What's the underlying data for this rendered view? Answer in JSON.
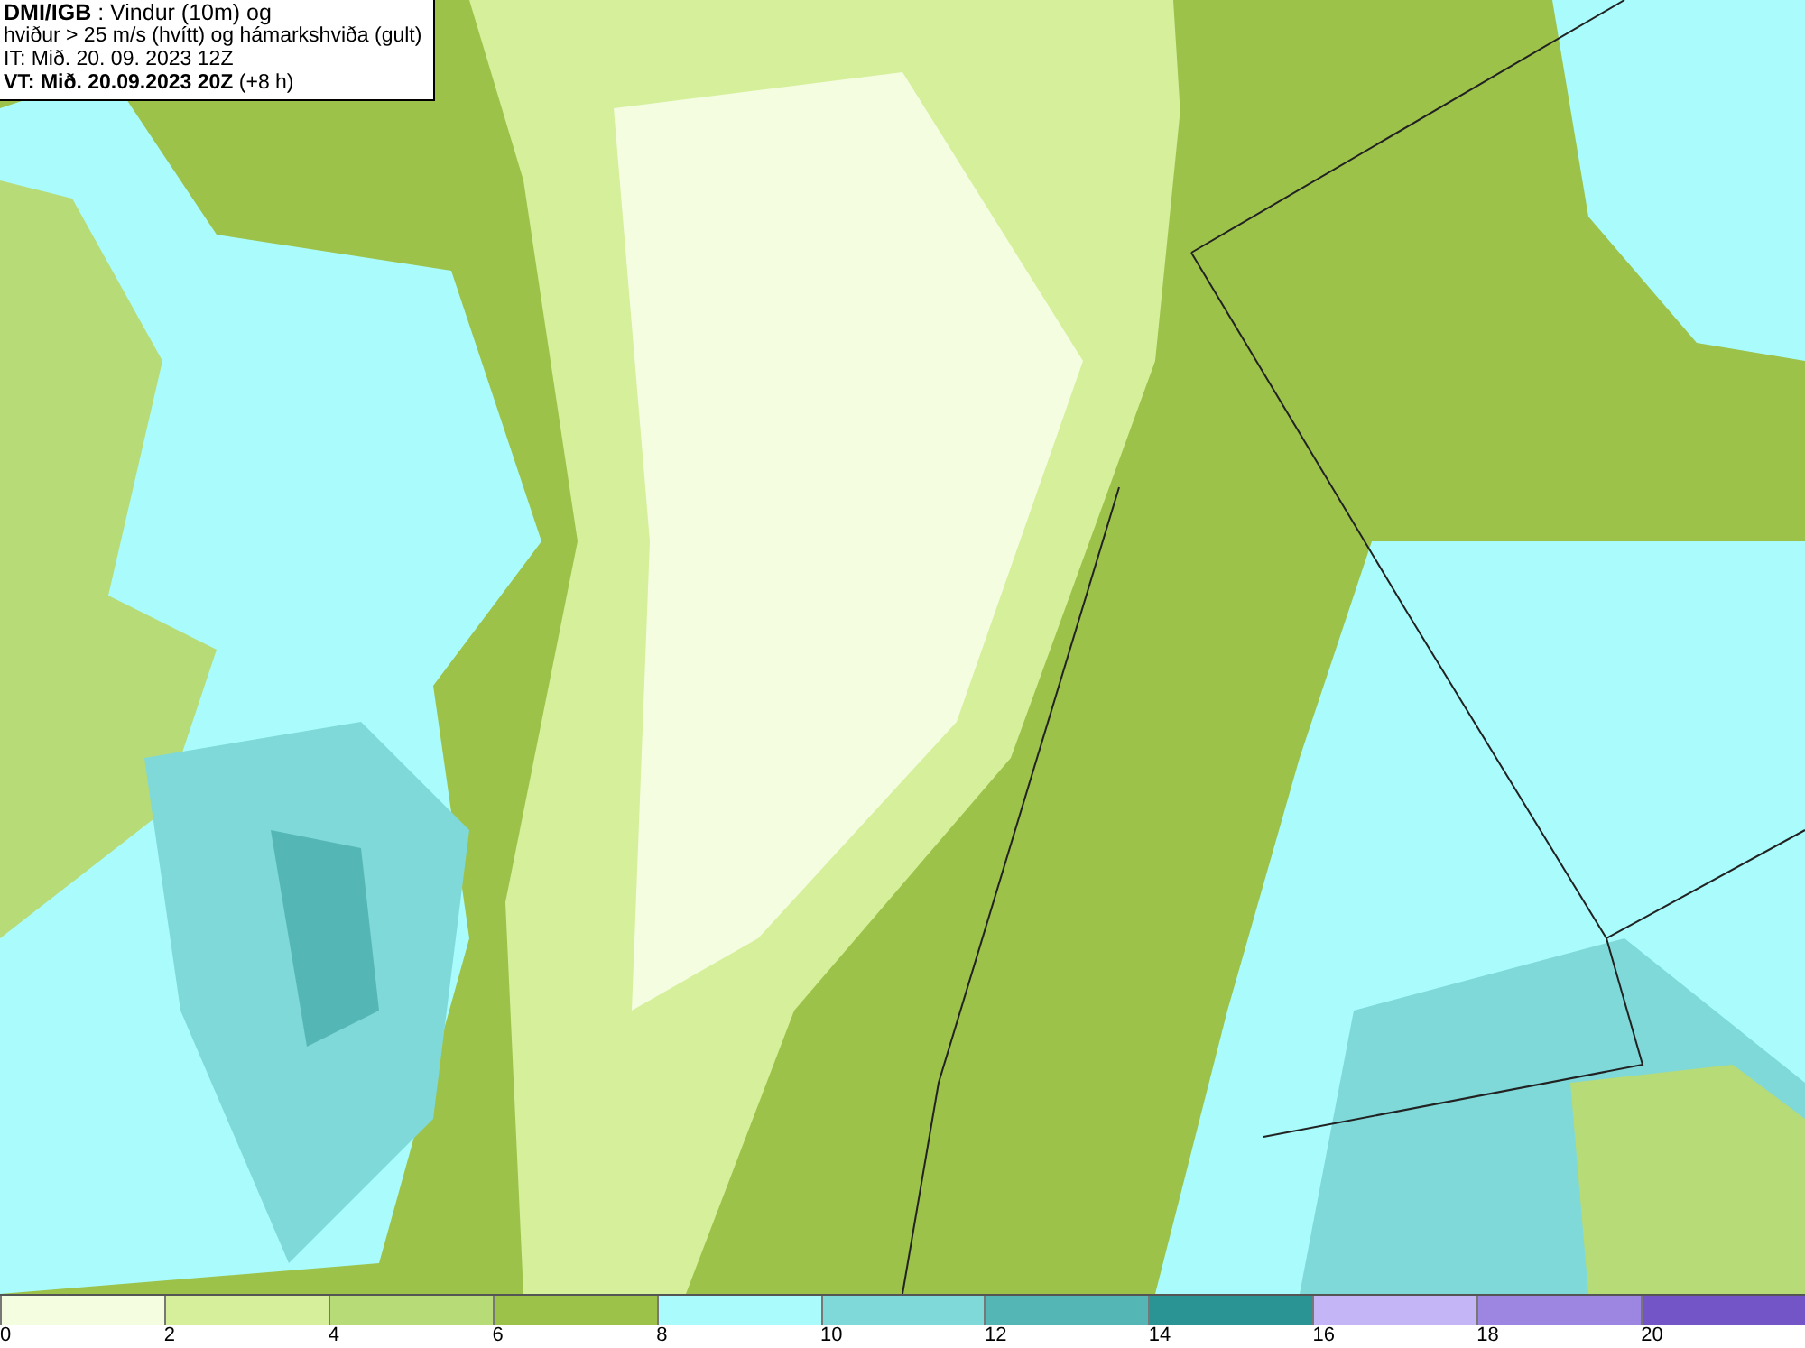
{
  "header": {
    "lines": [
      "**DMI/IGB** : Vindur (10m) og",
      "hviður > 25 m/s (hvítt) og hámarkshviða (gult)",
      "IT: Mið. 20. 09. 2023 12Z",
      "**VT: Mið. 20.09.2023 20Z** (+8 h)"
    ]
  },
  "legend": {
    "bins": [
      {
        "color": "#f4fde0",
        "label": "0"
      },
      {
        "color": "#d5ef9b",
        "label": "2"
      },
      {
        "color": "#b7db77",
        "label": "4"
      },
      {
        "color": "#9cc24a",
        "label": "6"
      },
      {
        "color": "#aafcfc",
        "label": "8"
      },
      {
        "color": "#7fd9d9",
        "label": "10"
      },
      {
        "color": "#55b6b6",
        "label": "12"
      },
      {
        "color": "#2a9393",
        "label": "14"
      },
      {
        "color": "#c3b5f6",
        "label": "16"
      },
      {
        "color": "#9c86e1",
        "label": "18"
      },
      {
        "color": "#7355c8",
        "label": "20"
      }
    ]
  }
}
